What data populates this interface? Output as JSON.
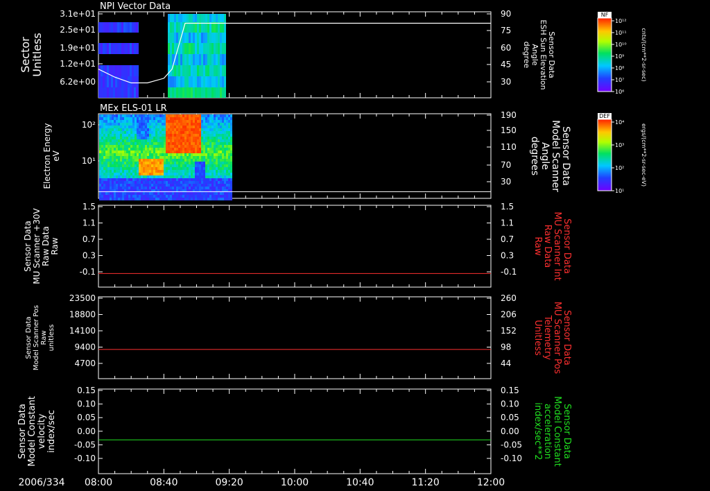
{
  "chart_data": [
    {
      "panel": "npi",
      "type": "heatmap",
      "title": "NPI Vector Data",
      "ylabel_left": [
        "Sector",
        "Unitless"
      ],
      "ylabel_right": [
        "Sensor Data",
        "ESH Sun Elevation",
        "Angle",
        "degree"
      ],
      "left_ticks": [
        "3.1e+01",
        "2.5e+01",
        "1.9e+01",
        "1.2e+01",
        "6.2e+00"
      ],
      "right_ticks": [
        "90",
        "75",
        "60",
        "45",
        "30"
      ],
      "ylim_right": [
        15,
        90
      ],
      "line_series": {
        "color": "#ffffff",
        "points": [
          [
            "08:00",
            40
          ],
          [
            "08:10",
            33
          ],
          [
            "08:20",
            28
          ],
          [
            "08:30",
            28
          ],
          [
            "08:40",
            32
          ],
          [
            "08:45",
            40
          ],
          [
            "08:50",
            65
          ],
          [
            "08:53",
            80
          ],
          [
            "12:00",
            80
          ]
        ]
      },
      "colorbar": {
        "label": "NF",
        "units": "cnts/(cm**2-sr-sec)",
        "ticks": [
          "10¹²",
          "10¹¹",
          "10¹⁰",
          "10⁹",
          "10⁸",
          "10⁷",
          "10⁶"
        ]
      }
    },
    {
      "panel": "els",
      "type": "heatmap",
      "title": "MEx ELS-01 LR",
      "ylabel_left": [
        "Electron Energy",
        "eV"
      ],
      "ylabel_right": [
        "Sensor Data",
        "Model Scanner",
        "Angle",
        "degrees"
      ],
      "left_ticks": [
        "10²",
        "10¹"
      ],
      "right_ticks": [
        "190",
        "150",
        "110",
        "70",
        "30"
      ],
      "ylim_right": [
        0,
        190
      ],
      "line_series": {
        "color": "#ffffff",
        "value": 15
      },
      "colorbar": {
        "label": "DEF",
        "units": "ergs/(cm**2-sr-sec-eV)",
        "ticks": [
          "10⁴",
          "10³",
          "10²",
          "10¹"
        ]
      }
    },
    {
      "panel": "scanner_int",
      "type": "line",
      "ylabel_left": [
        "Sensor Data",
        "MU Scanner +30V",
        "Raw Data",
        "Raw"
      ],
      "ylabel_right": [
        "Sensor Data",
        "MU Scanner Int",
        "Raw Data",
        "Raw"
      ],
      "left_ticks": [
        "1.5",
        "1.1",
        "0.7",
        "0.3",
        "-0.1"
      ],
      "right_ticks": [
        "1.5",
        "1.1",
        "0.7",
        "0.3",
        "-0.1"
      ],
      "ylim": [
        -0.3,
        1.5
      ],
      "series": [
        {
          "color": "#ff3030",
          "value": 0.0
        }
      ]
    },
    {
      "panel": "scanner_pos",
      "type": "line",
      "ylabel_left": [
        "Sensor Data",
        "Model Scanner Pos",
        "Raw",
        "unitless"
      ],
      "ylabel_right": [
        "Sensor Data",
        "MU Scanner Pos",
        "Telemetry",
        "Unitless"
      ],
      "left_ticks": [
        "23500",
        "18800",
        "14100",
        "9400",
        "4700"
      ],
      "right_ticks": [
        "260",
        "206",
        "152",
        "98",
        "44"
      ],
      "ylim": [
        0,
        23500
      ],
      "series": [
        {
          "color": "#ff3030",
          "value": 8400
        }
      ]
    },
    {
      "panel": "model_constant",
      "type": "line",
      "ylabel_left": [
        "Sensor Data",
        "Model Constant",
        "velocity",
        "index/sec"
      ],
      "ylabel_right": [
        "Sensor Data",
        "Model Constant",
        "acceleration",
        "index/sec**2"
      ],
      "left_ticks": [
        "0.15",
        "0.10",
        "0.05",
        "0.00",
        "-0.05",
        "-0.10"
      ],
      "right_ticks": [
        "0.15",
        "0.10",
        "0.05",
        "0.00",
        "-0.05",
        "-0.10"
      ],
      "ylim": [
        -0.1,
        0.15
      ],
      "series": [
        {
          "color": "#20e020",
          "value": 0.0
        }
      ]
    }
  ],
  "time_axis": {
    "date_label": "2006/334",
    "ticks": [
      "08:00",
      "08:40",
      "09:20",
      "10:00",
      "10:40",
      "11:20",
      "12:00"
    ],
    "range": [
      "08:00",
      "12:00"
    ]
  },
  "colors": {
    "background": "#000000",
    "axis": "#ffffff",
    "right_label_red": "#ff3030",
    "right_label_green": "#20e020"
  }
}
